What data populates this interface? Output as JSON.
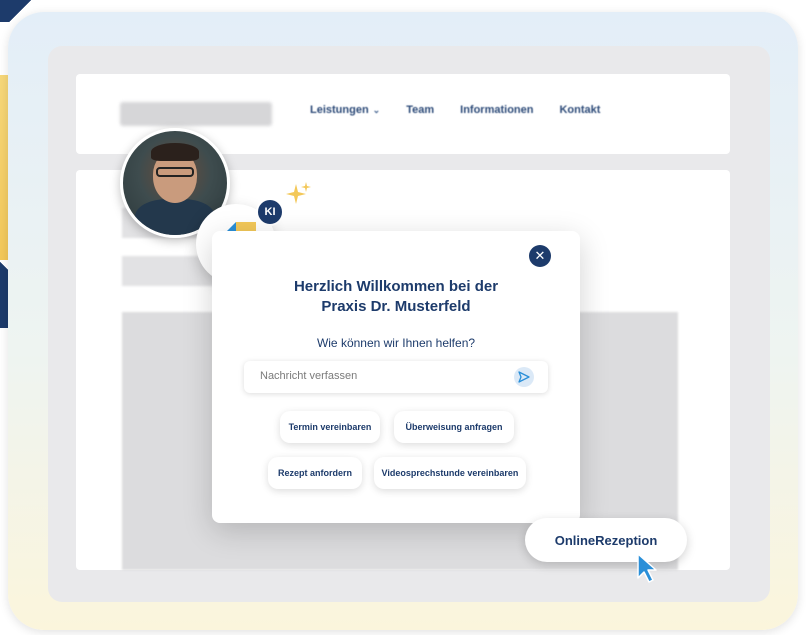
{
  "nav": {
    "items": [
      {
        "label": "Leistungen",
        "has_dropdown": true
      },
      {
        "label": "Team"
      },
      {
        "label": "Informationen"
      },
      {
        "label": "Kontakt"
      }
    ]
  },
  "badge": {
    "ki": "KI"
  },
  "dialog": {
    "title_line1": "Herzlich Willkommen bei der",
    "title_line2": "Praxis Dr. Musterfeld",
    "subtitle": "Wie können wir Ihnen helfen?",
    "input_placeholder": "Nachricht verfassen",
    "chips": [
      "Termin vereinbaren",
      "Überweisung anfragen",
      "Rezept anfordern",
      "Videosprechstunde vereinbaren"
    ]
  },
  "launcher": {
    "label": "OnlineRezeption"
  },
  "colors": {
    "brand_navy": "#1d3b6b",
    "brand_yellow": "#f3c859",
    "brand_blue": "#2a8fd8"
  }
}
